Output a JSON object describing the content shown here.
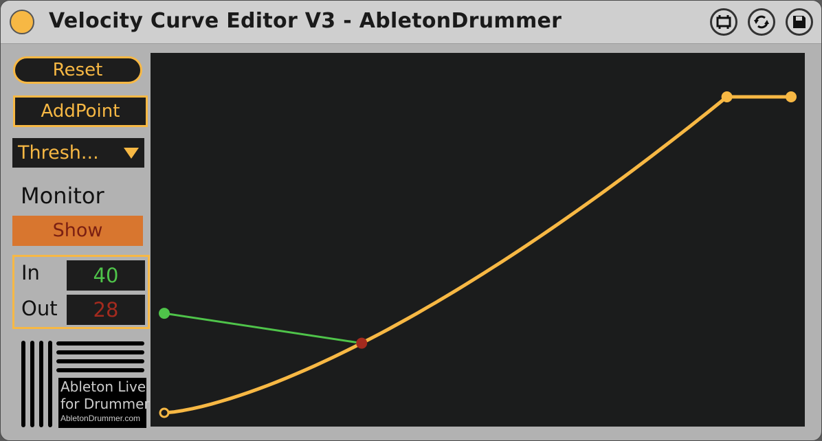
{
  "window": {
    "title": "Velocity Curve Editor V3 - AbletonDrummer"
  },
  "titlebar_icons": [
    "freeze-icon",
    "refresh-icon",
    "save-icon"
  ],
  "controls": {
    "reset_label": "Reset",
    "add_point_label": "AddPoint",
    "mode_dropdown_value": "Thresh...",
    "monitor_label": "Monitor",
    "show_label": "Show",
    "in_label": "In",
    "in_value": "40",
    "out_label": "Out",
    "out_value": "28"
  },
  "logo": {
    "line1": "Ableton Live",
    "line2": "for Drummer",
    "url": "AbletonDrummer.com"
  },
  "colors": {
    "accent": "#f7b844",
    "in_value": "#4fc44a",
    "out_value": "#a32a1e",
    "show_button": "#d8762f",
    "graph_bg": "#1b1c1c"
  },
  "curve": {
    "range": [
      0,
      127
    ],
    "points": [
      [
        0,
        0
      ],
      [
        114,
        127
      ],
      [
        127,
        127
      ]
    ],
    "monitor": {
      "in": 40,
      "out": 28
    }
  }
}
